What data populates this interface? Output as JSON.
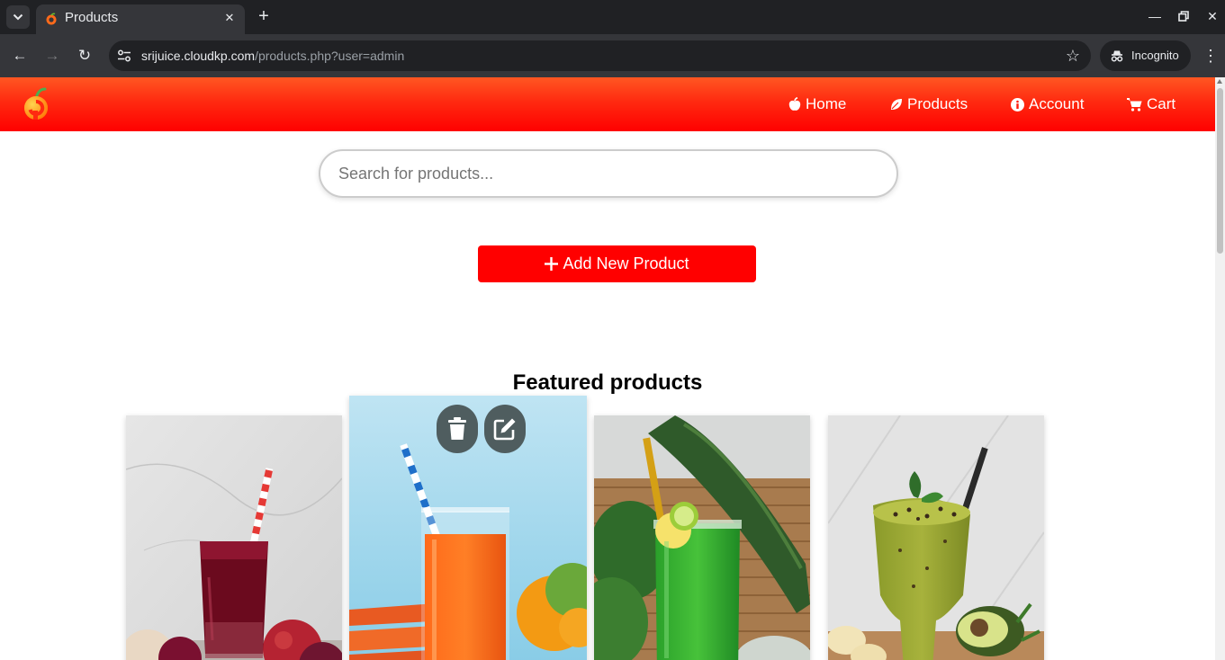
{
  "browser": {
    "tab_title": "Products",
    "url_host": "srijuice.cloudkp.com",
    "url_path": "/products.php?user=admin",
    "incognito_label": "Incognito"
  },
  "site": {
    "nav": [
      {
        "label": "Home",
        "icon": "apple-icon"
      },
      {
        "label": "Products",
        "icon": "leaf-icon"
      },
      {
        "label": "Account",
        "icon": "info-icon"
      },
      {
        "label": "Cart",
        "icon": "cart-icon"
      }
    ],
    "search_placeholder": "Search for products...",
    "add_button_label": "Add New Product",
    "featured_title": "Featured products"
  },
  "products": [
    {
      "image": "beetroot juice glass with apples and beets"
    },
    {
      "image": "carrot orange juice glass with striped straw",
      "actions": [
        "trash-icon",
        "edit-icon"
      ]
    },
    {
      "image": "green cucumber spinach juice with lemon"
    },
    {
      "image": "avocado banana smoothie with black straw"
    }
  ],
  "colors": {
    "header_top": "#ff5722",
    "header_bottom": "#ff0000",
    "add_button": "#ff0000",
    "action_button": "#4f5d5f"
  }
}
